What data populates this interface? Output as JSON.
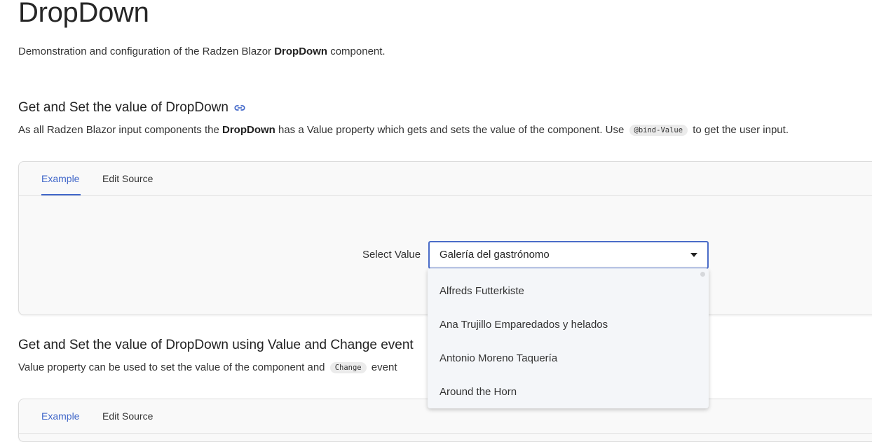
{
  "header": {
    "title": "DropDown",
    "desc_prefix": "Demonstration and configuration of the Radzen Blazor ",
    "desc_bold": "DropDown",
    "desc_suffix": " component."
  },
  "section1": {
    "title": "Get and Set the value of DropDown",
    "link_icon": "link-icon",
    "desc_prefix": "As all Radzen Blazor input components the ",
    "desc_bold": "DropDown",
    "desc_middle": " has a Value property which gets and sets the value of the component. Use ",
    "desc_code": "@bind-Value",
    "desc_suffix": " to get the user input."
  },
  "example1": {
    "tabs": [
      "Example",
      "Edit Source"
    ],
    "select_label": "Select Value",
    "dropdown_value": "Galería del gastrónomo",
    "options": [
      "Alfreds Futterkiste",
      "Ana Trujillo Emparedados y helados",
      "Antonio Moreno Taquería",
      "Around the Horn"
    ]
  },
  "section2": {
    "title": "Get and Set the value of DropDown using Value and Change event",
    "desc_prefix": "Value property can be used to set the value of the component and ",
    "desc_code": "Change",
    "desc_suffix": " event"
  },
  "example2": {
    "tabs": [
      "Example",
      "Edit Source"
    ]
  },
  "colors": {
    "accent": "#4167c9",
    "panel_bg": "#f4f6f9",
    "card_bg": "#f9f9f9"
  }
}
